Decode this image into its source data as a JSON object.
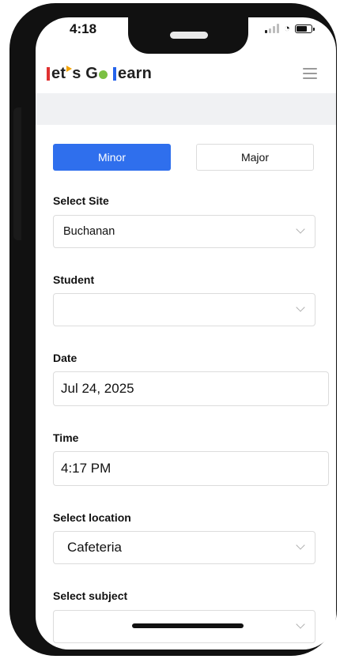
{
  "status_bar": {
    "time": "4:18"
  },
  "header": {
    "logo_text_1": "et",
    "logo_text_2": "s G",
    "logo_text_3": "earn"
  },
  "form": {
    "toggle": {
      "minor_label": "Minor",
      "major_label": "Major",
      "selected": "Minor"
    },
    "site": {
      "label": "Select Site",
      "value": "Buchanan"
    },
    "student": {
      "label": "Student",
      "value": ""
    },
    "date": {
      "label": "Date",
      "value": "Jul 24, 2025"
    },
    "time": {
      "label": "Time",
      "value": "4:17 PM"
    },
    "location": {
      "label": "Select location",
      "value": "Cafeteria"
    },
    "subject": {
      "label": "Select subject",
      "value": ""
    }
  },
  "colors": {
    "primary": "#2f6fed",
    "logo_red": "#e03131",
    "logo_green": "#7bc043",
    "logo_blue": "#2563eb",
    "logo_orange": "#f4a300"
  }
}
